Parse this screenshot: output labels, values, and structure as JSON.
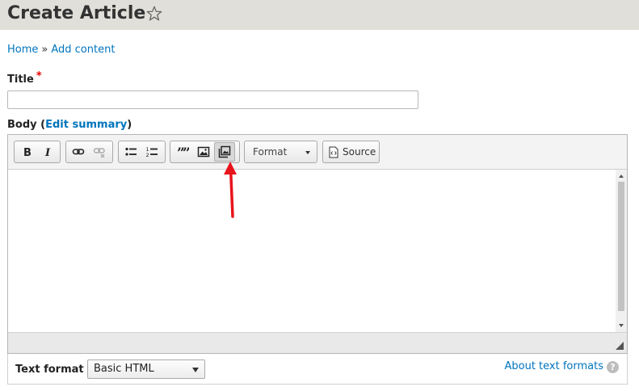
{
  "header": {
    "title": "Create Article",
    "star_icon": "star-outline-icon"
  },
  "breadcrumb": {
    "items": [
      "Home",
      "Add content"
    ],
    "separator": "»"
  },
  "form": {
    "title_label": "Title",
    "required_mark": "*",
    "title_value": "",
    "body_label": "Body",
    "body_open_paren": "(",
    "edit_summary_link": "Edit summary",
    "body_close_paren": ")"
  },
  "toolbar": {
    "groups": [
      [
        "bold-icon",
        "italic-icon"
      ],
      [
        "link-icon",
        "unlink-icon"
      ],
      [
        "bulleted-list-icon",
        "numbered-list-icon"
      ],
      [
        "blockquote-icon",
        "image-icon",
        "media-embed-icon"
      ]
    ],
    "format_label": "Format",
    "source_label": "Source",
    "active_button": "media-embed-icon"
  },
  "text_format": {
    "label": "Text format",
    "selected": "Basic HTML",
    "about_link": "About text formats",
    "help_symbol": "?"
  },
  "colors": {
    "link": "#0074bd",
    "required": "#e00000",
    "annotation_arrow": "#e8141b",
    "header_bg": "#e0dfd9"
  }
}
